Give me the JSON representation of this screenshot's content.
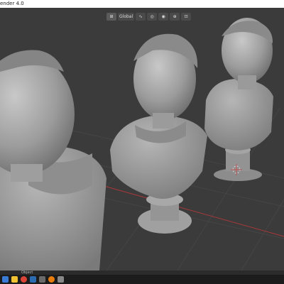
{
  "window": {
    "title": "ender 4.0"
  },
  "viewport_header": {
    "shading_mode": "Global",
    "icons": [
      "transform-pivot-icon",
      "snap-icon",
      "proportional-edit-icon",
      "overlay-icon",
      "gizmo-icon",
      "view-icon"
    ]
  },
  "statusbar": {
    "active_object_label": "Object"
  },
  "taskbar": {
    "icons": [
      {
        "name": "start-icon",
        "color": "#3a7bd5"
      },
      {
        "name": "file-explorer-icon",
        "color": "#f1c232"
      },
      {
        "name": "chrome-icon",
        "color": "#db4437"
      },
      {
        "name": "mail-icon",
        "color": "#2b6cb0"
      },
      {
        "name": "app-icon",
        "color": "#6a6a6a"
      },
      {
        "name": "blender-icon",
        "color": "#e87d0d"
      },
      {
        "name": "settings-icon",
        "color": "#888888"
      }
    ]
  },
  "colors": {
    "viewport_bg": "#3b3b3b",
    "sculpt": "#a9a9a9",
    "grid_red_axis": "#a8383a",
    "grid_line": "#474747"
  }
}
